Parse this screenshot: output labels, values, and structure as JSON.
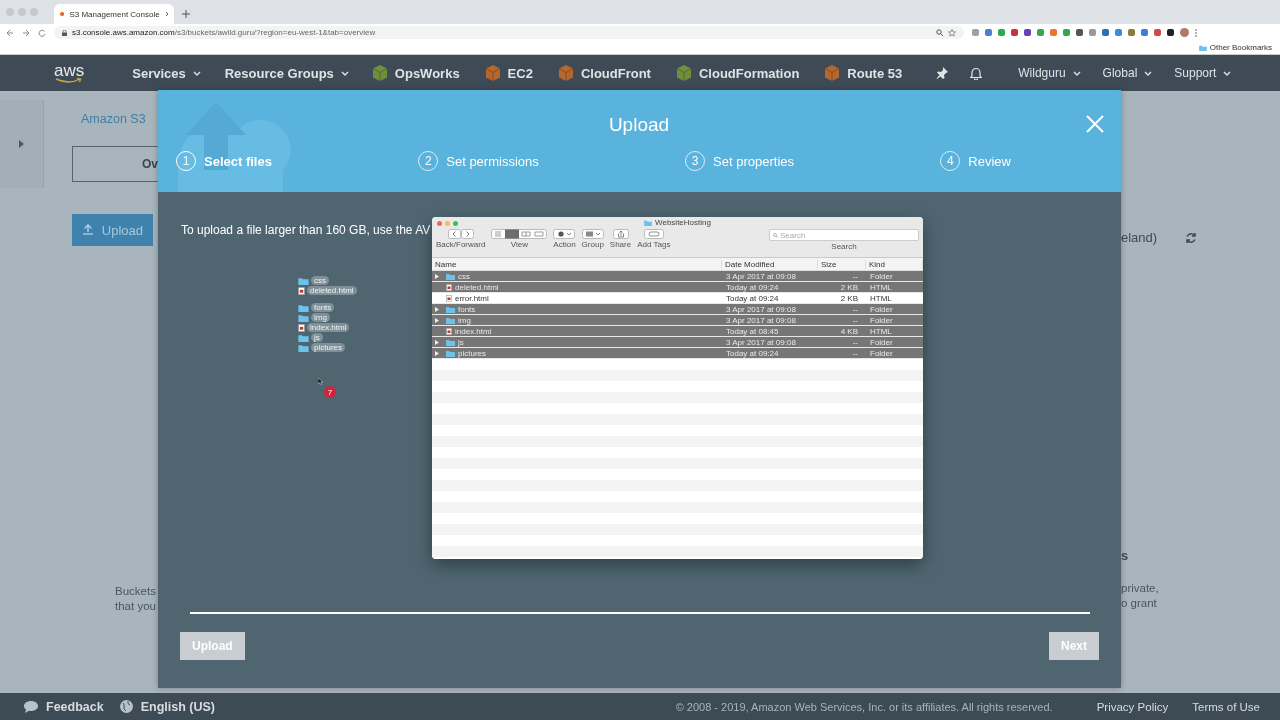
{
  "browser": {
    "tab_title": "S3 Management Console",
    "url_host": "s3.console.aws.amazon.com",
    "url_path": "/s3/buckets/awild.guru/?region=eu-west-1&tab=overview",
    "bookmark_folder": "Other Bookmarks"
  },
  "nav": {
    "logo": "aws",
    "menus": [
      {
        "label": "Services"
      },
      {
        "label": "Resource Groups"
      }
    ],
    "services": [
      {
        "label": "OpsWorks",
        "color": "#6f8f3c"
      },
      {
        "label": "EC2",
        "color": "#b5672e"
      },
      {
        "label": "CloudFront",
        "color": "#b5672e"
      },
      {
        "label": "CloudFormation",
        "color": "#6f8f3c"
      },
      {
        "label": "Route 53",
        "color": "#b5672e"
      }
    ],
    "account_menus": [
      {
        "label": "Wildguru"
      },
      {
        "label": "Global"
      },
      {
        "label": "Support"
      }
    ]
  },
  "page": {
    "breadcrumb": "Amazon S3",
    "tab": "Ov",
    "upload_button": "Upload",
    "region_fragment": "eland)",
    "heading_fragment": "s",
    "left_text": [
      "Buckets",
      "that you"
    ],
    "right_text": [
      "private,",
      "o grant"
    ]
  },
  "modal": {
    "title": "Upload",
    "steps": [
      {
        "number": "1",
        "label": "Select files",
        "selected": true
      },
      {
        "number": "2",
        "label": "Set permissions",
        "selected": false
      },
      {
        "number": "3",
        "label": "Set properties",
        "selected": false
      },
      {
        "number": "4",
        "label": "Review",
        "selected": false
      }
    ],
    "notice": "To upload a file larger than 160 GB, use the AV",
    "drag_preview": {
      "groups": [
        {
          "items": [
            {
              "name": "css",
              "kind": "folder"
            },
            {
              "name": "deleted.html",
              "kind": "file"
            }
          ]
        },
        {
          "items": [
            {
              "name": "fonts",
              "kind": "folder"
            },
            {
              "name": "img",
              "kind": "folder"
            },
            {
              "name": "index.html",
              "kind": "file"
            },
            {
              "name": "js",
              "kind": "folder"
            },
            {
              "name": "pictures",
              "kind": "folder"
            }
          ]
        }
      ],
      "count": "7"
    },
    "finder": {
      "title": "WebsiteHosting",
      "toolbar": [
        "Back/Forward",
        "View",
        "Action",
        "Group",
        "Share",
        "Add Tags"
      ],
      "search_placeholder": "Search",
      "search_label": "Search",
      "columns": [
        "Name",
        "Date Modified",
        "Size",
        "Kind"
      ],
      "rows": [
        {
          "name": "css",
          "kind": "folder",
          "date": "3 Apr 2017 at 09:08",
          "size": "--",
          "kind_label": "Folder",
          "selected": true
        },
        {
          "name": "deleted.html",
          "kind": "file",
          "date": "Today at 09:24",
          "size": "2 KB",
          "kind_label": "HTML",
          "selected": true
        },
        {
          "name": "error.html",
          "kind": "file",
          "date": "Today at 09:24",
          "size": "2 KB",
          "kind_label": "HTML",
          "selected": false
        },
        {
          "name": "fonts",
          "kind": "folder",
          "date": "3 Apr 2017 at 09:08",
          "size": "--",
          "kind_label": "Folder",
          "selected": true
        },
        {
          "name": "img",
          "kind": "folder",
          "date": "3 Apr 2017 at 09:08",
          "size": "--",
          "kind_label": "Folder",
          "selected": true
        },
        {
          "name": "index.html",
          "kind": "file",
          "date": "Today at 08:45",
          "size": "4 KB",
          "kind_label": "HTML",
          "selected": true
        },
        {
          "name": "js",
          "kind": "folder",
          "date": "3 Apr 2017 at 09:08",
          "size": "--",
          "kind_label": "Folder",
          "selected": true
        },
        {
          "name": "pictures",
          "kind": "folder",
          "date": "Today at 09:24",
          "size": "--",
          "kind_label": "Folder",
          "selected": true
        }
      ]
    },
    "buttons": [
      {
        "label": "Upload",
        "disabled": true
      },
      {
        "label": "Next",
        "disabled": true
      }
    ]
  },
  "footer": {
    "feedback": "Feedback",
    "language": "English (US)",
    "copyright": "© 2008 - 2019, Amazon Web Services, Inc. or its affiliates. All rights reserved.",
    "links": [
      "Privacy Policy",
      "Terms of Use"
    ]
  }
}
